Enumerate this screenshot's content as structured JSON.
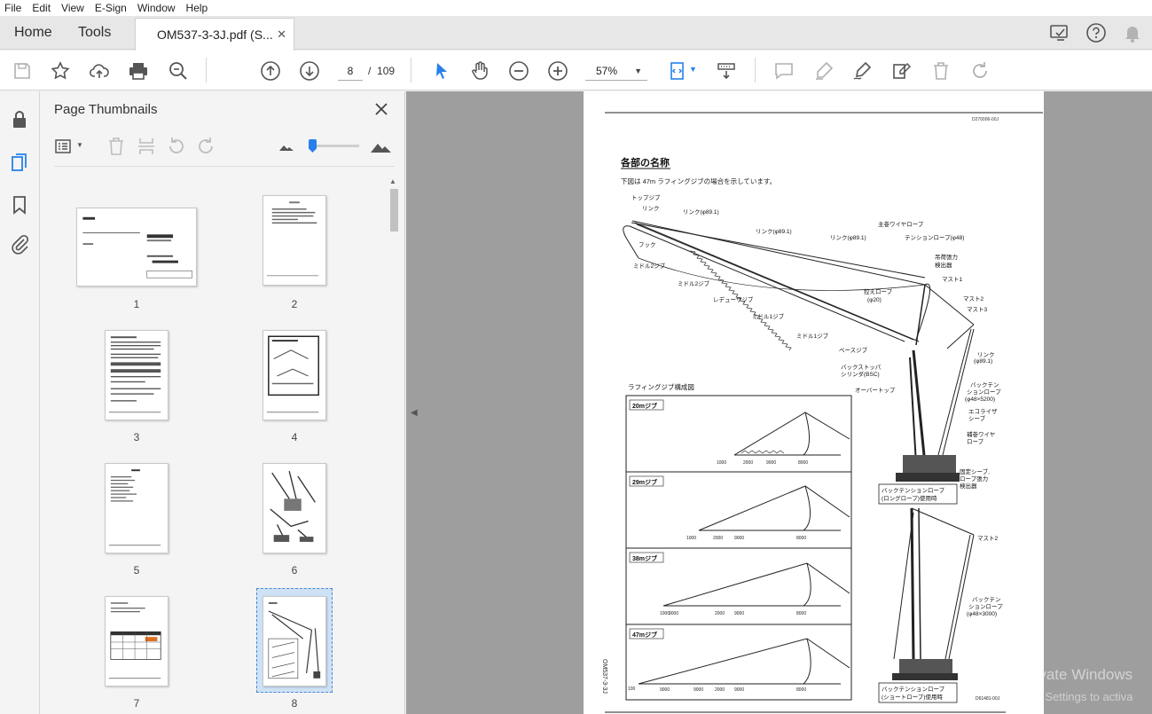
{
  "menu": [
    "File",
    "Edit",
    "View",
    "E-Sign",
    "Window",
    "Help"
  ],
  "tabs": {
    "home": "Home",
    "tools": "Tools",
    "document": "OM537-3-3J.pdf (S...",
    "close_glyph": "✕"
  },
  "toolbar": {
    "current_page": "8",
    "page_separator": "/",
    "total_pages": "109",
    "zoom": "57%"
  },
  "thumbnails_panel": {
    "title": "Page Thumbnails",
    "pages": [
      "1",
      "2",
      "3",
      "4",
      "5",
      "6",
      "7",
      "8"
    ],
    "selected_page": "8"
  },
  "document_page": {
    "doc_code": "D270006-00J",
    "heading": "各部の名称",
    "intro": "下図は 47m ラフィングジブの場合を示しています。",
    "labels": {
      "top_jib": "トップジブ",
      "link": "リンク",
      "link_89_1": "リンク(φ89.1)",
      "main_wire": "主巻ワイヤロープ",
      "tension_rope": "テンションロープ(φ48)",
      "hook": "フック",
      "middle2_jib": "ミドル2ジブ",
      "load_detector": "吊荷張力\n検出器",
      "mast1": "マスト1",
      "guy_rope": "控えロープ\n(φ20)",
      "lattice_jib": "レデューサジブ",
      "middle1_jib": "ミドル1ジブ",
      "mast2": "マスト2",
      "mast3": "マスト3",
      "base_jib": "ベースジブ",
      "backstop": "バックストッパ\nシリンダ(BSC)",
      "overtop": "オーバートップ",
      "back_tension": "バックテン\nションロープ\n(φ48×5200)",
      "equalizer": "エコライザ\nシーブ",
      "aux_wire": "補巻ワイヤ\nロープ",
      "fixed_sheave": "固定シーブ,\nロープ張力\n検出器",
      "luffing_diagram": "ラフィングジブ構成図",
      "long_rope": "バックテンションロープ\n(ロングロープ)使用時",
      "short_rope": "バックテンションロープ\n(ショートロープ)使用時",
      "mast2b": "マスト2",
      "back_tension_b": "バックテン\nションロープ\n(φ48×3000)",
      "side_code": "OM537-3-3J",
      "fig_code": "D61481-00J"
    },
    "configs": [
      {
        "name": "20mジブ",
        "dims": [
          "2000",
          "9000",
          "8000"
        ],
        "left": "1000"
      },
      {
        "name": "29mジブ",
        "dims": [
          "2000",
          "9000",
          "8000"
        ],
        "left": "1000"
      },
      {
        "name": "38mジブ",
        "dims": [
          "9000",
          "2000",
          "9000",
          "8000"
        ],
        "left": "1000"
      },
      {
        "name": "47mジブ",
        "dims": [
          "9000",
          "9000",
          "2000",
          "9000",
          "8000"
        ],
        "left": "100"
      }
    ]
  },
  "watermark": {
    "line1": "Activate Windows",
    "line2": "Go to Settings to activa"
  }
}
